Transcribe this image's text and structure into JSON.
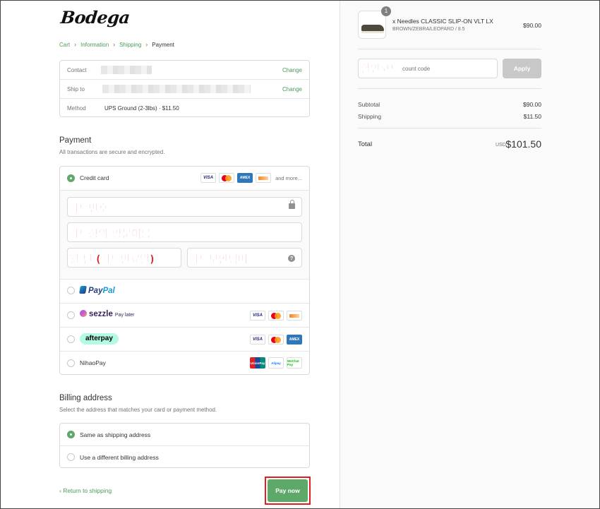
{
  "brand": "Bodega",
  "breadcrumb": {
    "items": [
      "Cart",
      "Information",
      "Shipping",
      "Payment"
    ],
    "separator": "›"
  },
  "review": {
    "contact": {
      "label": "Contact",
      "change": "Change"
    },
    "ship_to": {
      "label": "Ship to",
      "change": "Change"
    },
    "method": {
      "label": "Method",
      "value": "UPS Ground (2-3lbs) · $11.50"
    }
  },
  "payment": {
    "title": "Payment",
    "subtitle": "All transactions are secure and encrypted.",
    "credit_card": {
      "label": "Credit card",
      "more": "and more...",
      "card_number_annotation": "카드번호",
      "name_annotation": "카드상의 영문이름",
      "expiry_annotation": "월 년 (카드만료일)",
      "security_annotation": "카드보안넘버",
      "help": "?"
    },
    "paypal": {
      "p1": "Pay",
      "p2": "Pal"
    },
    "sezzle": {
      "name": "sezzle",
      "later": "Pay later"
    },
    "afterpay": {
      "name": "afterpay"
    },
    "nihaopay": {
      "label": "NihaoPay"
    },
    "card_brands": {
      "visa": "VISA",
      "amex": "AMEX",
      "unionpay": "UnionPay",
      "alipay": "Alipay",
      "wechat": "WeChat Pay"
    }
  },
  "billing": {
    "title": "Billing address",
    "subtitle": "Select the address that matches your card or payment method.",
    "same": "Same as shipping address",
    "different": "Use a different billing address"
  },
  "footer": {
    "back": "‹ Return to shipping",
    "pay": "Pay now"
  },
  "summary": {
    "item": {
      "qty": "1",
      "name": "x Needles CLASSIC SLIP-ON VLT LX",
      "variant": "BROWN/ZEBRA/LEOPARD / 8.5",
      "price": "$90.00"
    },
    "discount": {
      "annotation": "할인코드",
      "placeholder_visible": "count code",
      "apply": "Apply"
    },
    "subtotal": {
      "label": "Subtotal",
      "value": "$90.00"
    },
    "shipping": {
      "label": "Shipping",
      "value": "$11.50"
    },
    "total": {
      "label": "Total",
      "currency": "USD",
      "value": "$101.50"
    }
  },
  "colors": {
    "accent": "#5ea86a",
    "link": "#4a9a5a",
    "annotation": "#e02020"
  }
}
